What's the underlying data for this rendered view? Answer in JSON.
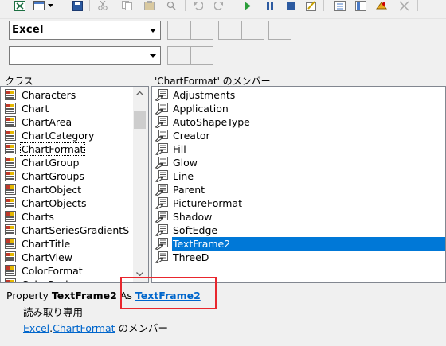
{
  "toolbar": {
    "icons": [
      "excel-view-icon",
      "insert-module-icon",
      "save-icon",
      "cut-icon",
      "copy-icon",
      "paste-icon",
      "find-icon",
      "undo-icon",
      "redo-icon",
      "run-icon",
      "break-icon",
      "reset-icon",
      "design-mode-icon",
      "project-explorer-icon",
      "properties-icon",
      "object-browser-icon",
      "toolbox-icon"
    ]
  },
  "library_combo": {
    "value": "Excel"
  },
  "search_combo": {
    "value": ""
  },
  "classes_header": "クラス",
  "members_header": "'ChartFormat' のメンバー",
  "classes": [
    "Characters",
    "Chart",
    "ChartArea",
    "ChartCategory",
    "ChartFormat",
    "ChartGroup",
    "ChartGroups",
    "ChartObject",
    "ChartObjects",
    "Charts",
    "ChartSeriesGradientS",
    "ChartTitle",
    "ChartView",
    "ColorFormat",
    "ColorScale"
  ],
  "classes_focused_index": 4,
  "members": [
    "Adjustments",
    "Application",
    "AutoShapeType",
    "Creator",
    "Fill",
    "Glow",
    "Line",
    "Parent",
    "PictureFormat",
    "Shadow",
    "SoftEdge",
    "TextFrame2",
    "ThreeD"
  ],
  "members_selected_index": 11,
  "details": {
    "property_keyword": "Property",
    "member_name": "TextFrame2",
    "as_keyword": "As",
    "type_link": "TextFrame2",
    "readonly_text": "読み取り専用",
    "lib_link": "Excel",
    "dot": ".",
    "class_link": "ChartFormat",
    "member_of_text": "のメンバー"
  },
  "colors": {
    "selection": "#0078d7",
    "link": "#0066cc",
    "highlight_box": "#e8262d"
  }
}
